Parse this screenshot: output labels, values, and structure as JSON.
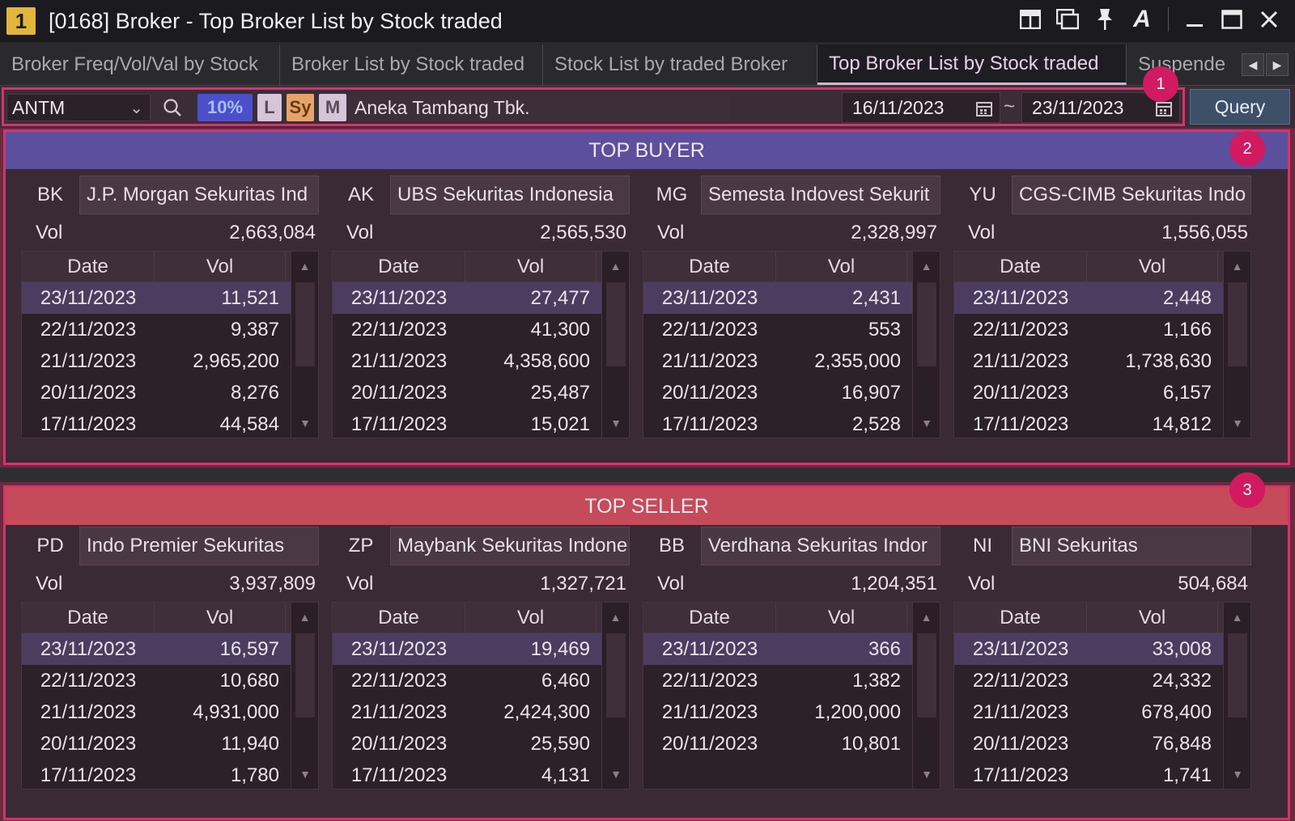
{
  "window": {
    "badge": "1",
    "title": "[0168] Broker - Top Broker List by Stock traded"
  },
  "tabs": [
    {
      "label": "Broker Freq/Vol/Val by Stock"
    },
    {
      "label": "Broker List by Stock traded"
    },
    {
      "label": "Stock List by traded Broker"
    },
    {
      "label": "Top Broker List by Stock traded"
    },
    {
      "label": "Suspende"
    }
  ],
  "query": {
    "stock_code": "ANTM",
    "tags": {
      "pct": "10%",
      "l": "L",
      "sy": "Sy",
      "m": "M"
    },
    "stock_name": "Aneka Tambang Tbk.",
    "date_from": "16/11/2023",
    "separator": "~",
    "date_to": "23/11/2023",
    "button": "Query"
  },
  "markers": {
    "m1": "1",
    "m2": "2",
    "m3": "3"
  },
  "top_buyer": {
    "header": "TOP BUYER",
    "col_date": "Date",
    "col_vol": "Vol",
    "vol_label": "Vol",
    "brokers": [
      {
        "code": "BK",
        "name": "J.P. Morgan Sekuritas Ind",
        "vol": "2,663,084",
        "rows": [
          [
            "23/11/2023",
            "11,521"
          ],
          [
            "22/11/2023",
            "9,387"
          ],
          [
            "21/11/2023",
            "2,965,200"
          ],
          [
            "20/11/2023",
            "8,276"
          ],
          [
            "17/11/2023",
            "44,584"
          ]
        ]
      },
      {
        "code": "AK",
        "name": "UBS Sekuritas Indonesia",
        "vol": "2,565,530",
        "rows": [
          [
            "23/11/2023",
            "27,477"
          ],
          [
            "22/11/2023",
            "41,300"
          ],
          [
            "21/11/2023",
            "4,358,600"
          ],
          [
            "20/11/2023",
            "25,487"
          ],
          [
            "17/11/2023",
            "15,021"
          ]
        ]
      },
      {
        "code": "MG",
        "name": "Semesta Indovest Sekurit",
        "vol": "2,328,997",
        "rows": [
          [
            "23/11/2023",
            "2,431"
          ],
          [
            "22/11/2023",
            "553"
          ],
          [
            "21/11/2023",
            "2,355,000"
          ],
          [
            "20/11/2023",
            "16,907"
          ],
          [
            "17/11/2023",
            "2,528"
          ]
        ]
      },
      {
        "code": "YU",
        "name": "CGS-CIMB Sekuritas Indo",
        "vol": "1,556,055",
        "rows": [
          [
            "23/11/2023",
            "2,448"
          ],
          [
            "22/11/2023",
            "1,166"
          ],
          [
            "21/11/2023",
            "1,738,630"
          ],
          [
            "20/11/2023",
            "6,157"
          ],
          [
            "17/11/2023",
            "14,812"
          ]
        ]
      }
    ]
  },
  "top_seller": {
    "header": "TOP SELLER",
    "col_date": "Date",
    "col_vol": "Vol",
    "vol_label": "Vol",
    "brokers": [
      {
        "code": "PD",
        "name": "Indo Premier Sekuritas",
        "vol": "3,937,809",
        "rows": [
          [
            "23/11/2023",
            "16,597"
          ],
          [
            "22/11/2023",
            "10,680"
          ],
          [
            "21/11/2023",
            "4,931,000"
          ],
          [
            "20/11/2023",
            "11,940"
          ],
          [
            "17/11/2023",
            "1,780"
          ]
        ]
      },
      {
        "code": "ZP",
        "name": "Maybank Sekuritas Indone",
        "vol": "1,327,721",
        "rows": [
          [
            "23/11/2023",
            "19,469"
          ],
          [
            "22/11/2023",
            "6,460"
          ],
          [
            "21/11/2023",
            "2,424,300"
          ],
          [
            "20/11/2023",
            "25,590"
          ],
          [
            "17/11/2023",
            "4,131"
          ]
        ]
      },
      {
        "code": "BB",
        "name": "Verdhana Sekuritas Indor",
        "vol": "1,204,351",
        "rows": [
          [
            "23/11/2023",
            "366"
          ],
          [
            "22/11/2023",
            "1,382"
          ],
          [
            "21/11/2023",
            "1,200,000"
          ],
          [
            "20/11/2023",
            "10,801"
          ]
        ]
      },
      {
        "code": "NI",
        "name": "BNI Sekuritas",
        "vol": "504,684",
        "rows": [
          [
            "23/11/2023",
            "33,008"
          ],
          [
            "22/11/2023",
            "24,332"
          ],
          [
            "21/11/2023",
            "678,400"
          ],
          [
            "20/11/2023",
            "76,848"
          ],
          [
            "17/11/2023",
            "1,741"
          ]
        ]
      }
    ]
  }
}
